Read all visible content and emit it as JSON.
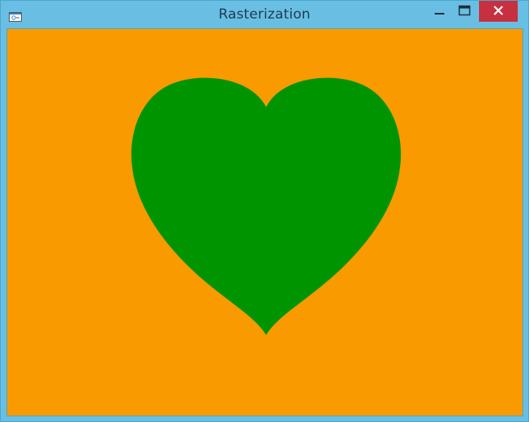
{
  "window": {
    "title": "Rasterization"
  },
  "icons": {
    "app": "app-icon",
    "minimize": "minimize-icon",
    "maximize": "maximize-icon",
    "close": "close-icon"
  },
  "colors": {
    "title_bar": "#69bfe3",
    "canvas_background": "#f99a00",
    "heart_fill": "#009400",
    "close_button": "#c7313f"
  },
  "canvas": {
    "shape": "heart"
  }
}
